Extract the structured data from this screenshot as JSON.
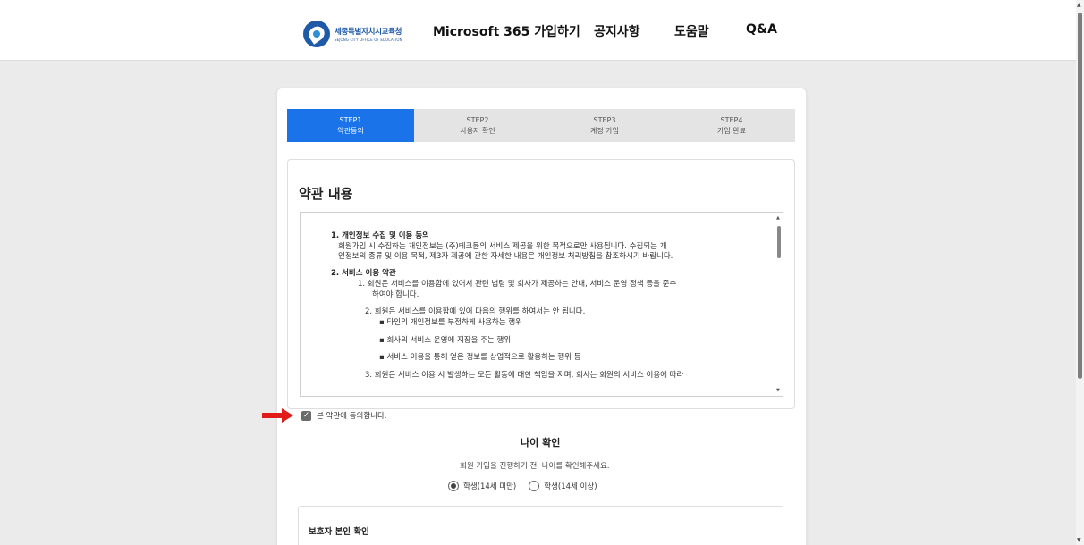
{
  "header": {
    "logo": {
      "name_ko": "세종특별자치시교육청",
      "name_en": "SEJONG CITY OFFICE OF EDUCATION"
    },
    "nav": [
      "Microsoft 365 가입하기",
      "공지사항",
      "도움말",
      "Q&A"
    ]
  },
  "steps": [
    {
      "step": "STEP1",
      "label": "약관동의",
      "active": true
    },
    {
      "step": "STEP2",
      "label": "사용자 확인",
      "active": false
    },
    {
      "step": "STEP3",
      "label": "계정 가입",
      "active": false
    },
    {
      "step": "STEP4",
      "label": "가입 완료",
      "active": false
    }
  ],
  "terms": {
    "title": "약관 내용",
    "s1_title": "1. 개인정보 수집 및 이용 동의",
    "s1_body_line1": "회원가입 시 수집하는 개인정보는 (주)테크뮴의 서비스 제공을 위한 목적으로만 사용됩니다. 수집되는 개",
    "s1_body_line2": "인정보의 종류 및 이용 목적, 제3자 제공에 관한 자세한 내용은 개인정보 처리방침을 참조하시기 바랍니다.",
    "s2_title": "2. 서비스 이용 약관",
    "s2_item1_line1": "1. 회원은 서비스를 이용함에 있어서 관련 법령 및 회사가 제공하는 안내, 서비스 운영 정책 등을 준수",
    "s2_item1_line2": "하여야 합니다.",
    "s2_item2": "2. 회원은 서비스를 이용함에 있어 다음의 행위를 하여서는 안 됩니다.",
    "s2_item2_bullets": [
      "타인의 개인정보를 부정하게 사용하는 행위",
      "회사의 서비스 운영에 지장을 주는 행위",
      "서비스 이용을 통해 얻은 정보를 상업적으로 활용하는 행위 등"
    ],
    "s2_item3": "3. 회원은 서비스 이용 시 발생하는 모든 활동에 대한 책임을 지며, 회사는 회원의 서비스 이용에 따라"
  },
  "agree": {
    "label": "본 약관에 동의합니다.",
    "checked": true
  },
  "age": {
    "title": "나이 확인",
    "description": "회원 가입을 진행하기 전, 나이를 확인해주세요.",
    "options": [
      "학생(14세 미만)",
      "학생(14세 이상)"
    ],
    "selected": "학생(14세 미만)"
  },
  "guardian": {
    "title": "보호자 본인 확인"
  },
  "colors": {
    "accent": "#1a73e8",
    "annotation_arrow": "#e11a1a"
  }
}
